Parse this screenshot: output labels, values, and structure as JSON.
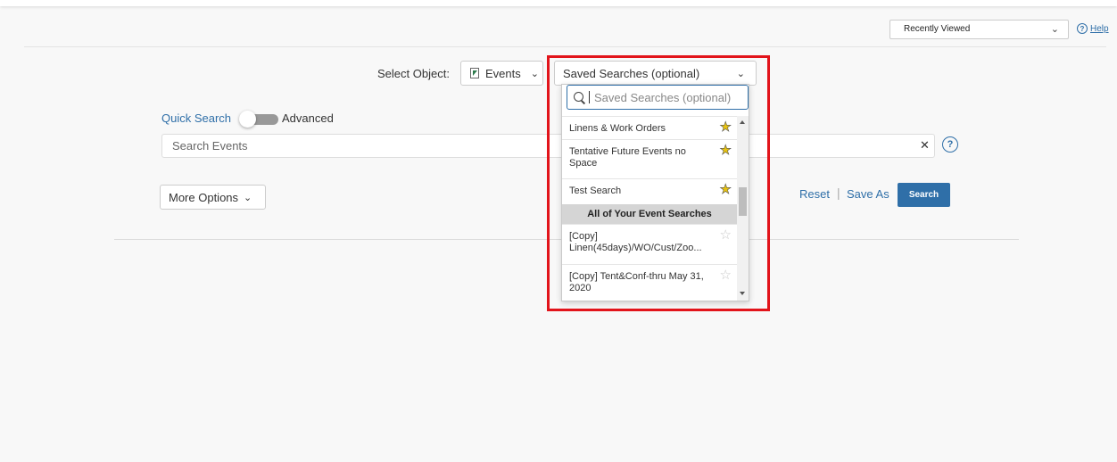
{
  "header": {
    "recently_viewed": {
      "selected": "Recently Viewed"
    },
    "help_label": "Help"
  },
  "object_selector": {
    "label": "Select Object:",
    "selected_object": "Events",
    "object_icon": "events-icon"
  },
  "saved_searches": {
    "selected_label": "Saved Searches (optional)",
    "search_placeholder": "Saved Searches (optional)",
    "items": [
      {
        "label": "Linens & Work Orders",
        "starred": true
      },
      {
        "label": "Tentative Future Events no Space",
        "starred": true
      },
      {
        "label": "Test Search",
        "starred": true
      }
    ],
    "group_header": "All of Your Event Searches",
    "group_items": [
      {
        "label": "[Copy] Linen(45days)/WO/Cust/Zoo...",
        "starred": false
      },
      {
        "label": "[Copy] Tent&Conf-thru May 31, 2020",
        "starred": false
      }
    ]
  },
  "search_mode": {
    "quick_label": "Quick Search",
    "advanced_label": "Advanced",
    "toggle_on": false
  },
  "search": {
    "placeholder": "Search Events",
    "value": ""
  },
  "actions": {
    "more_options_label": "More Options",
    "reset_label": "Reset",
    "save_as_label": "Save As",
    "search_button_label": "Search",
    "separator": "|"
  },
  "colors": {
    "accent": "#2f6fa8",
    "highlight": "#e2141b",
    "star": "#e8c30f"
  }
}
